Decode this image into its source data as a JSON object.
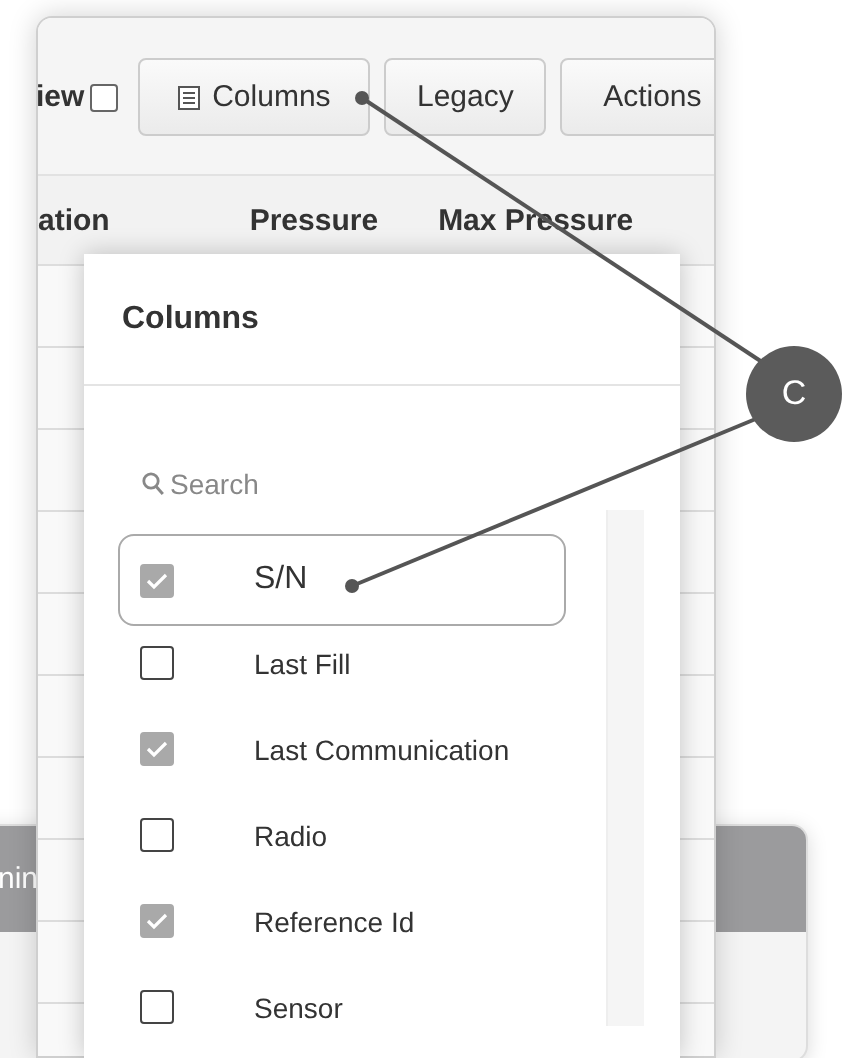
{
  "toolbar": {
    "view_label": "iew",
    "view_checked": false,
    "buttons": [
      {
        "kind": "icon",
        "label": "Columns"
      },
      {
        "kind": "plain",
        "label": "Legacy"
      },
      {
        "kind": "plain",
        "label": "Actions"
      }
    ]
  },
  "table": {
    "columns": [
      "ation",
      "Pressure",
      "Max Pressure"
    ]
  },
  "columns_popover": {
    "title": "Columns",
    "search": {
      "placeholder": "Search"
    },
    "items": [
      {
        "label": "S/N",
        "checked": true,
        "selected": true
      },
      {
        "label": "Last Fill",
        "checked": false,
        "selected": false
      },
      {
        "label": "Last Communication",
        "checked": true,
        "selected": false
      },
      {
        "label": "Radio",
        "checked": false,
        "selected": false
      },
      {
        "label": "Reference Id",
        "checked": true,
        "selected": false
      },
      {
        "label": "Sensor",
        "checked": false,
        "selected": false
      }
    ]
  },
  "background_window": {
    "tab_label": "nin"
  },
  "callout": {
    "label": "C"
  }
}
